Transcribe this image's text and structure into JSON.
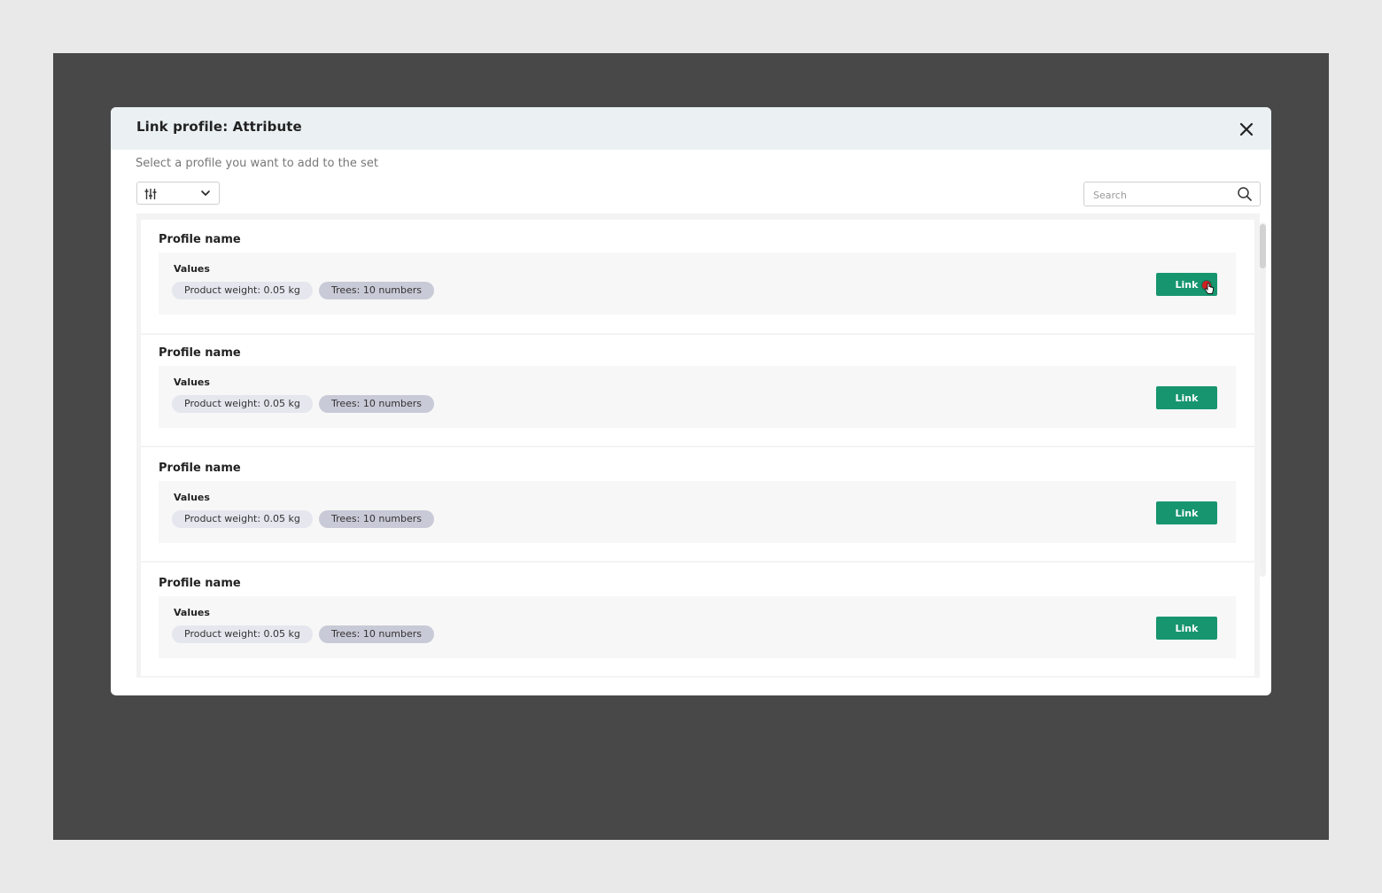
{
  "dialog": {
    "title": "Link profile: Attribute",
    "subtitle": "Select a profile you want to add to the set"
  },
  "toolbar": {
    "filter_icon": "sliders-icon",
    "dropdown_icon": "chevron-down-icon",
    "search_placeholder": "Search",
    "search_value": ""
  },
  "profiles": [
    {
      "name": "Profile name",
      "values_label": "Values",
      "tags": [
        "Product weight: 0.05 kg",
        "Trees: 10 numbers"
      ],
      "link_label": "Link"
    },
    {
      "name": "Profile name",
      "values_label": "Values",
      "tags": [
        "Product weight: 0.05 kg",
        "Trees: 10 numbers"
      ],
      "link_label": "Link"
    },
    {
      "name": "Profile name",
      "values_label": "Values",
      "tags": [
        "Product weight: 0.05 kg",
        "Trees: 10 numbers"
      ],
      "link_label": "Link"
    },
    {
      "name": "Profile name",
      "values_label": "Values",
      "tags": [
        "Product weight: 0.05 kg",
        "Trees: 10 numbers"
      ],
      "link_label": "Link"
    }
  ],
  "colors": {
    "backdrop": "#484848",
    "header_bg": "#ebf1f3",
    "link_button": "#17956f",
    "tag_light": "#e5e6ee",
    "tag_dark": "#c9cad7"
  }
}
